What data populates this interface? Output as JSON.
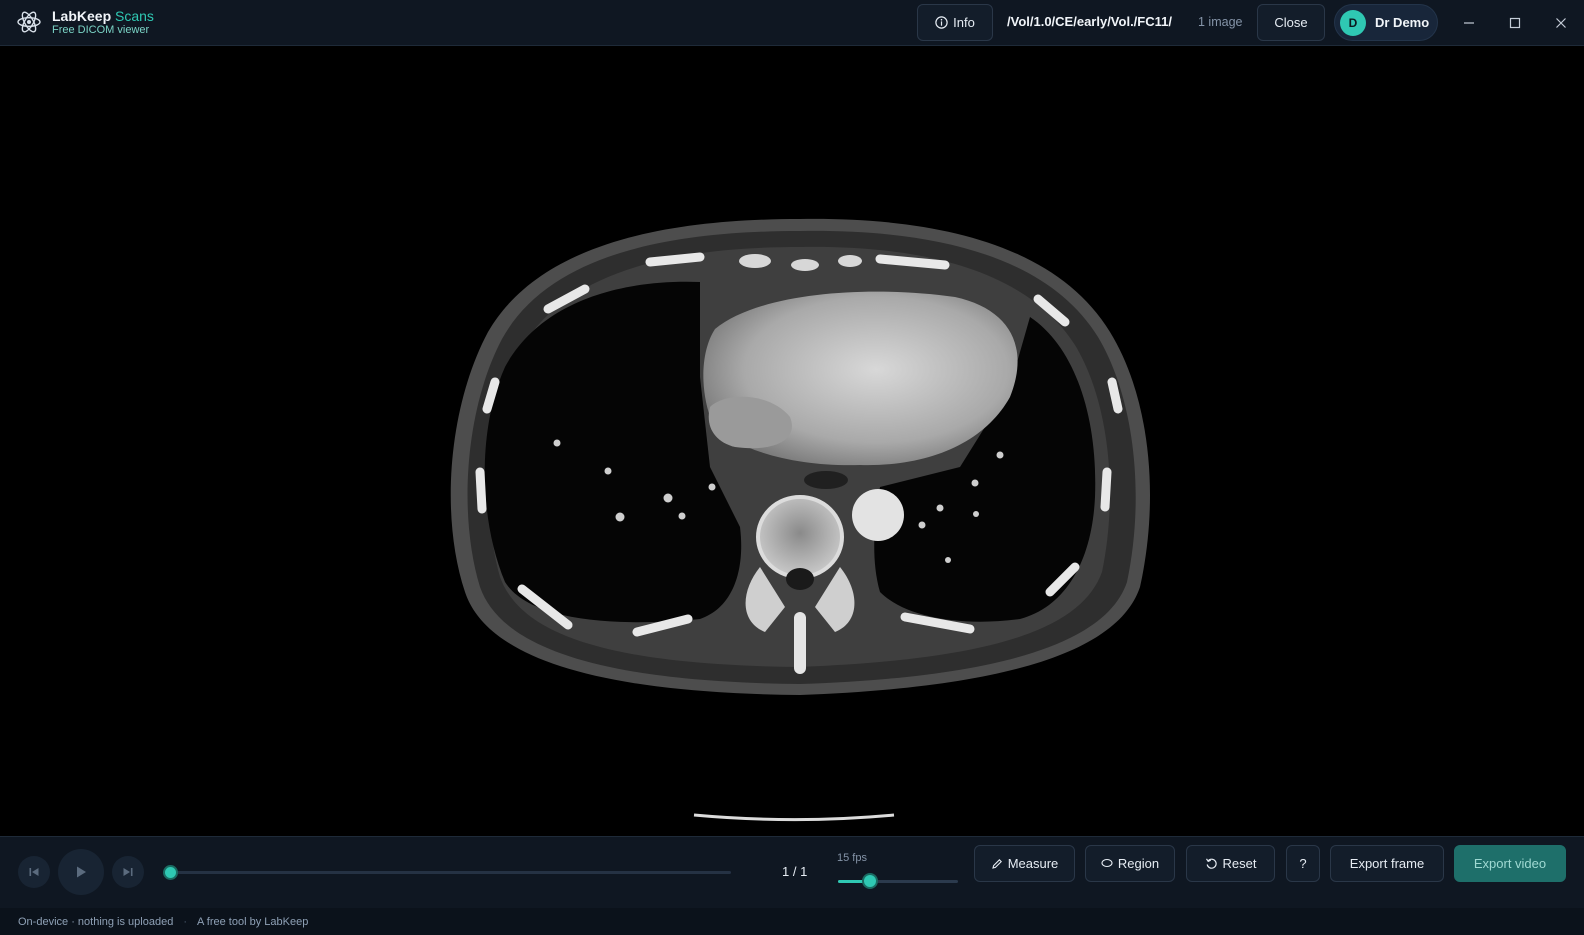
{
  "header": {
    "brand_name": "LabKeep",
    "brand_accent": "Scans",
    "brand_subtitle": "Free DICOM viewer",
    "info_label": "Info",
    "path": "/Vol/1.0/CE/early/Vol./FC11/",
    "image_count": "1 image",
    "close_label": "Close",
    "user_initial": "D",
    "user_name": "Dr Demo"
  },
  "viewer": {
    "image_desc": "Axial chest CT slice (heart, lungs, spine)"
  },
  "toolbar": {
    "frame_counter": "1 / 1",
    "fps_label": "15 fps",
    "fps_level": 0.27,
    "scrub_position": 0,
    "measure_label": "Measure",
    "region_label": "Region",
    "reset_label": "Reset",
    "help_label": "?",
    "export_frame_label": "Export frame",
    "export_video_label": "Export video"
  },
  "footer": {
    "privacy": "On-device · nothing is uploaded",
    "separator": "·",
    "credit": "A free tool by LabKeep"
  },
  "colors": {
    "accent": "#2fc8b3",
    "header_bg": "#0f1722",
    "export_video_bg": "#1e6f6a"
  },
  "icons": [
    "atom-logo-icon",
    "info-icon",
    "minimize-icon",
    "maximize-icon",
    "close-icon",
    "skip-back-icon",
    "play-icon",
    "skip-forward-icon",
    "pencil-icon",
    "region-icon",
    "reset-icon"
  ]
}
